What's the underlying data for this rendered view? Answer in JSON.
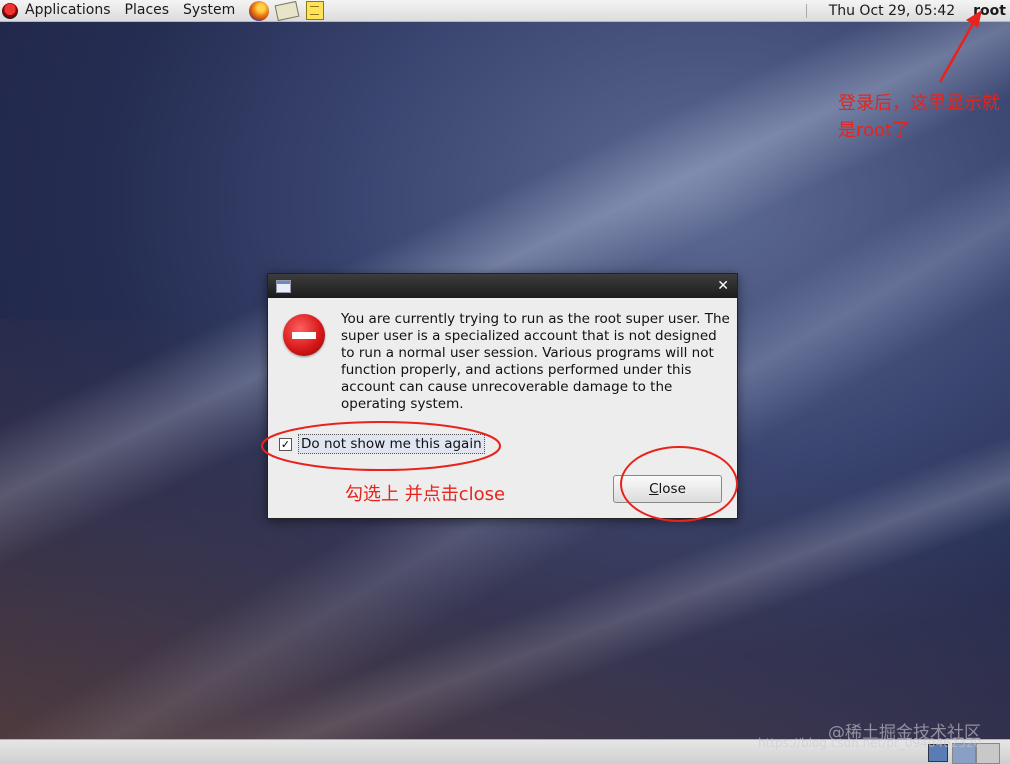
{
  "top_panel": {
    "menus": [
      "Applications",
      "Places",
      "System"
    ],
    "clock": "Thu Oct 29, 05:42",
    "user": "root"
  },
  "dialog": {
    "message": "You are currently trying to run as the root super user.  The super user is a specialized account that is not designed to run a normal user session.  Various programs will not function properly, and actions performed under this account can cause unrecoverable damage to the operating system.",
    "checkbox_label": "Do not show me this again",
    "checkbox_checked": true,
    "close_label": "Close",
    "close_mnemonic": "C",
    "close_rest": "lose"
  },
  "annotations": {
    "top_note": "登录后，这里显示就是root了",
    "dialog_note": "勾选上 并点击close",
    "color": "#e8231c"
  },
  "watermark": {
    "main": "@稀土掘金技术社区",
    "url": "https://blog.csdn.net/pr_0940462320"
  }
}
